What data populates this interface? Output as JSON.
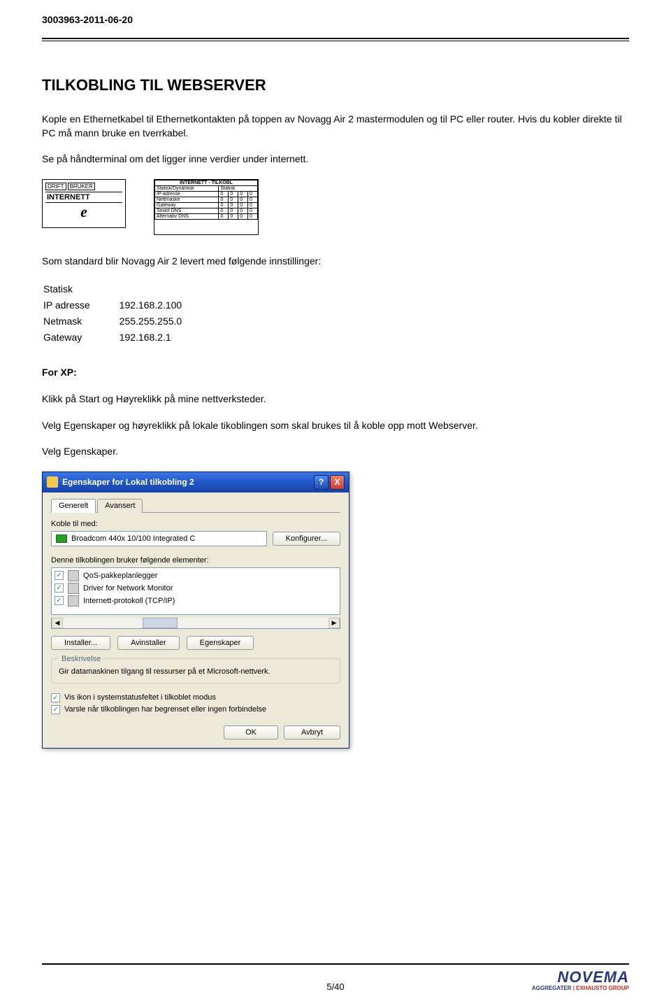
{
  "doc_id": "3003963-2011-06-20",
  "title": "TILKOBLING TIL WEBSERVER",
  "paragraphs": {
    "p1": "Kople en Ethernetkabel til Ethernetkontakten på toppen av Novagg Air 2 mastermodulen og til PC eller router. Hvis du kobler direkte til PC må mann bruke en tverrkabel.",
    "p2": "Se på håndterminal om det ligger inne verdier under internett.",
    "p3": "Som standard blir Novagg Air 2  levert med følgende innstillinger:",
    "p4": "Klikk på Start og Høyreklikk på mine nettverksteder.",
    "p5": "Velg Egenskaper og høyreklikk på lokale tikoblingen som skal brukes til å koble opp mott Webserver.",
    "p6": "Velg Egenskaper."
  },
  "lcd1": {
    "tab1": "DRIFT",
    "tab2": "BRUKER",
    "label": "INTERNETT",
    "icon": "e"
  },
  "lcd2": {
    "header1": "INTERNETT - TILKOBL",
    "row_mode": "Statisk/Dynamisk",
    "mode_val": "Statisk",
    "rows": [
      "IP-adresse",
      "Nettmaske",
      "Gateway",
      "Smart DNS",
      "Alternativ DNS"
    ]
  },
  "settings": {
    "static_label": "Statisk",
    "ip_label": "IP adresse",
    "ip_val": "192.168.2.100",
    "netmask_label": "Netmask",
    "netmask_val": "255.255.255.0",
    "gateway_label": "Gateway",
    "gateway_val": "192.168.2.1"
  },
  "for_xp": "For XP:",
  "xp": {
    "title": "Egenskaper for Lokal tilkobling 2",
    "help_btn": "?",
    "close_btn": "X",
    "tab_general": "Generelt",
    "tab_advanced": "Avansert",
    "connect_with": "Koble til med:",
    "device": "Broadcom 440x 10/100 Integrated C",
    "configure": "Konfigurer...",
    "uses_elements": "Denne tilkoblingen bruker følgende elementer:",
    "items": [
      "QoS-pakkeplanlegger",
      "Driver for Network Monitor",
      "Internett-protokoll (TCP/IP)"
    ],
    "install": "Installer...",
    "uninstall": "Avinstaller",
    "properties": "Egenskaper",
    "description_label": "Beskrivelse",
    "description_text": "Gir datamaskinen tilgang til ressurser på et Microsoft-nettverk.",
    "show_icon": "Vis ikon i systemstatusfeltet i tilkoblet modus",
    "notify_limited": "Varsle når tilkoblingen har begrenset eller ingen forbindelse",
    "ok": "OK",
    "cancel": "Avbryt"
  },
  "footer": {
    "page": "5/40",
    "logo": "NOVEMA",
    "sub_agg": "AGGREGATER",
    "sub_sep": " | ",
    "sub_exh": "EXHAUSTO GROUP"
  }
}
